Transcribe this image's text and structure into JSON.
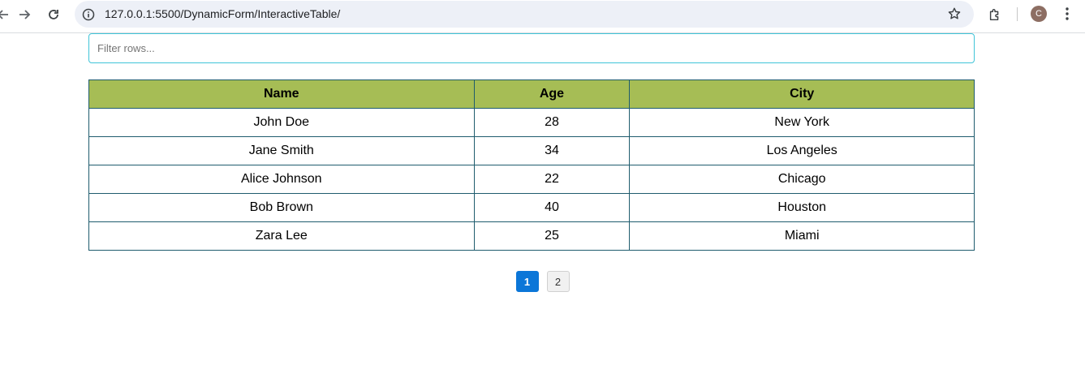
{
  "browser": {
    "url": "127.0.0.1:5500/DynamicForm/InteractiveTable/",
    "profile_initial": "C"
  },
  "filter": {
    "placeholder": "Filter rows...",
    "value": ""
  },
  "table": {
    "headers": [
      "Name",
      "Age",
      "City"
    ],
    "rows": [
      [
        "John Doe",
        "28",
        "New York"
      ],
      [
        "Jane Smith",
        "34",
        "Los Angeles"
      ],
      [
        "Alice Johnson",
        "22",
        "Chicago"
      ],
      [
        "Bob Brown",
        "40",
        "Houston"
      ],
      [
        "Zara Lee",
        "25",
        "Miami"
      ]
    ]
  },
  "pagination": {
    "pages": [
      "1",
      "2"
    ],
    "active": "1"
  },
  "colors": {
    "header_bg": "#a6bd55",
    "border": "#1f5c6e",
    "active_page": "#0b76d8",
    "filter_border": "#40c4d8"
  }
}
